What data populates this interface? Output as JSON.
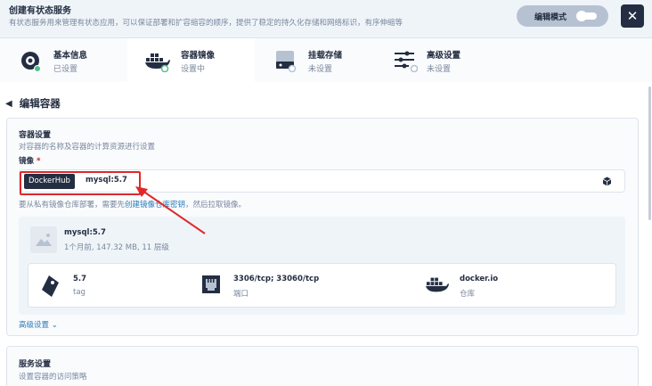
{
  "header": {
    "title": "创建有状态服务",
    "subtitle": "有状态服务用来管理有状态应用，可以保证部署和扩容缩容的顺序，提供了稳定的持久化存储和网络标识，有序伸缩等",
    "edit_mode_label": "编辑模式",
    "close_icon": "✕"
  },
  "steps": [
    {
      "title": "基本信息",
      "status": "已设置",
      "icon": "settings-dial-icon"
    },
    {
      "title": "容器镜像",
      "status": "设置中",
      "icon": "docker-whale-icon"
    },
    {
      "title": "挂载存储",
      "status": "未设置",
      "icon": "storage-disk-icon"
    },
    {
      "title": "高级设置",
      "status": "未设置",
      "icon": "sliders-icon"
    }
  ],
  "page": {
    "back_title": "编辑容器"
  },
  "container_settings": {
    "title": "容器设置",
    "desc": "对容器的名称及容器的计算资源进行设置",
    "image_label": "镜像",
    "required_mark": "*",
    "registry_tag": "DockerHub",
    "image_value": "mysql:5.7",
    "hint_prefix": "要从私有镜像仓库部署，需要先",
    "hint_link": "创建镜像仓库密钥",
    "hint_suffix": "，然后拉取镜像。",
    "image_info": {
      "name": "mysql:5.7",
      "meta": "1个月前, 147.32 MB, 11 层级",
      "tag_value": "5.7",
      "tag_label": "tag",
      "port_value": "3306/tcp; 33060/tcp",
      "port_label": "端口",
      "repo_value": "docker.io",
      "repo_label": "仓库"
    },
    "advanced_link": "高级设置"
  },
  "service_settings": {
    "title": "服务设置",
    "desc": "设置容器的访问策略"
  },
  "colors": {
    "accent_link": "#2a7ab8",
    "highlight_red": "#e0282a",
    "step_done_green": "#55bc8a",
    "dark": "#242e42"
  }
}
